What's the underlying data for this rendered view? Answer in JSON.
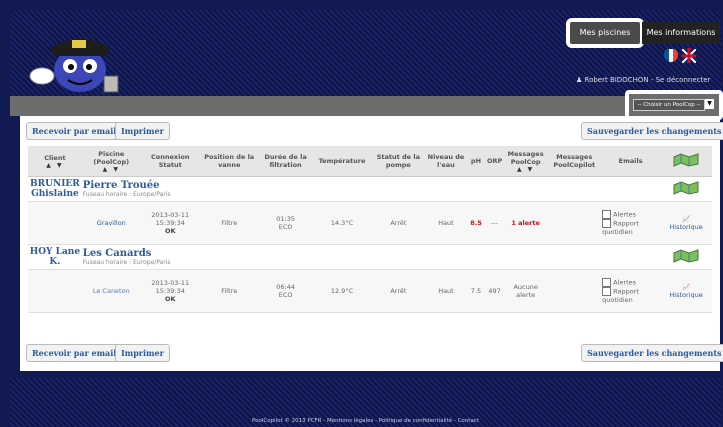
{
  "header": {
    "tabs": [
      {
        "label": "Mes piscines"
      },
      {
        "label": "Mes informations"
      }
    ],
    "user": "Robert BIDOCHON - Se déconnecter",
    "select_value": "-- Choisir un PoolCop --"
  },
  "toolbar": {
    "email_label": "Recevoir par email",
    "print_label": "Imprimer",
    "save_label": "Sauvegarder les changements"
  },
  "table": {
    "headers": {
      "client": "Client",
      "piscine": "Piscine (PoolCop)",
      "connexion": "Connexion Statut",
      "vanne": "Position de la vanne",
      "filtration": "Durée de la filtration",
      "temperature": "Température",
      "pompe": "Statut de la pompe",
      "niveau": "Niveau de l'eau",
      "ph": "pH",
      "orp": "ORP",
      "messages_poolcop": "Messages PoolCop",
      "messages_poolcopilot": "Messages PoolCopilot",
      "emails": "Emails"
    },
    "sort_arrows": "▲ ▼",
    "clients": [
      {
        "client": "BRUNIER Ghislaine",
        "pool_name": "Pierre Trouée",
        "timezone": "Fuseau horaire : Europe/Paris",
        "pool": "Gravillon",
        "date": "2013-03-11",
        "time": "15:39:34",
        "status": "OK",
        "vanne": "Filtre",
        "duration": "01:35",
        "duration_mode": "ECO",
        "temperature": "14.3°C",
        "pompe": "Arrêt",
        "niveau": "Haut",
        "ph": "8.5",
        "orp": "---",
        "messages": "1 alerte",
        "email_alertes": "Alertes",
        "email_rapport": "Rapport quotidien",
        "historique": "Historique"
      },
      {
        "client": "HOY Lane K.",
        "pool_name": "Les Canards",
        "timezone": "Fuseau horaire : Europe/Paris",
        "pool": "Le Caneton",
        "date": "2013-03-11",
        "time": "15:39:34",
        "status": "OK",
        "vanne": "Filtre",
        "duration": "06:44",
        "duration_mode": "ECO",
        "temperature": "12.9°C",
        "pompe": "Arrêt",
        "niveau": "Haut",
        "ph": "7.5",
        "orp": "497",
        "messages": "Aucune alerte",
        "email_alertes": "Alertes",
        "email_rapport": "Rapport quotidien",
        "historique": "Historique"
      }
    ]
  },
  "footer": {
    "text": "PoolCopilot © 2013 PCFR - Mentions légales - Politique de confidentialité - Contact"
  },
  "colors": {
    "accent": "#2b5a9e",
    "alert": "#c0151b",
    "navy": "#121a52"
  }
}
